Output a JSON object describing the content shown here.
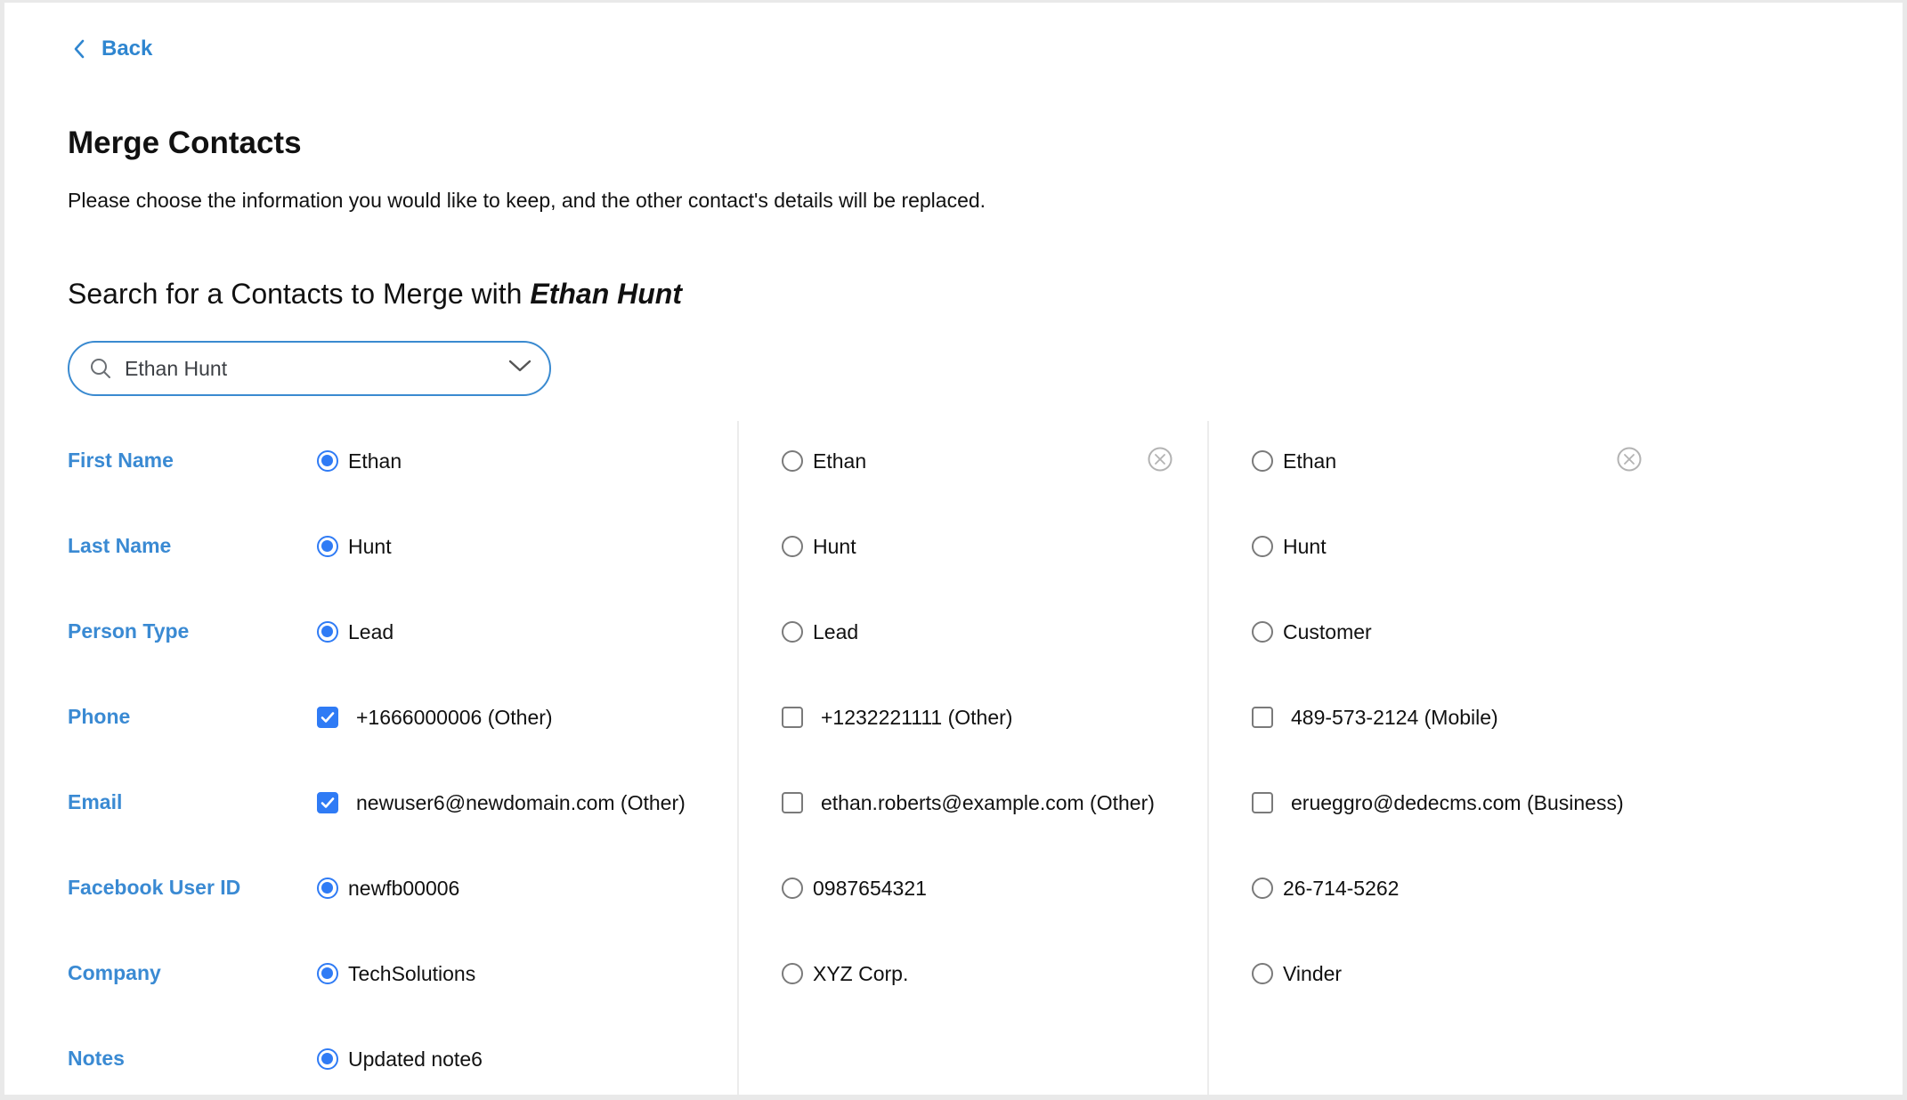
{
  "nav": {
    "back_label": "Back"
  },
  "header": {
    "title": "Merge Contacts",
    "description": "Please choose the information you would like to keep, and the other contact's details will be replaced."
  },
  "search": {
    "heading_prefix": "Search for a Contacts to Merge with ",
    "heading_name": "Ethan Hunt",
    "value": "Ethan Hunt",
    "icon": "search-icon",
    "dropdown_icon": "chevron-down-icon"
  },
  "colors": {
    "accent": "#2f7bf5",
    "label": "#3a8ad3",
    "link": "#2f86d0",
    "search_border": "#3a8ad0",
    "divider": "#ececec"
  },
  "fields": [
    {
      "label": "First Name",
      "type": "radio"
    },
    {
      "label": "Last Name",
      "type": "radio"
    },
    {
      "label": "Person Type",
      "type": "radio"
    },
    {
      "label": "Phone",
      "type": "checkbox"
    },
    {
      "label": "Email",
      "type": "checkbox"
    },
    {
      "label": "Facebook User ID",
      "type": "radio"
    },
    {
      "label": "Company",
      "type": "radio"
    },
    {
      "label": "Notes",
      "type": "radio"
    }
  ],
  "contacts": [
    {
      "removable": false,
      "values": [
        {
          "text": "Ethan",
          "selected": true
        },
        {
          "text": "Hunt",
          "selected": true
        },
        {
          "text": "Lead",
          "selected": true
        },
        {
          "text": "+1666000006 (Other)",
          "selected": true
        },
        {
          "text": "newuser6@newdomain.com (Other)",
          "selected": true
        },
        {
          "text": "newfb00006",
          "selected": true
        },
        {
          "text": "TechSolutions",
          "selected": true
        },
        {
          "text": "Updated note6",
          "selected": true
        }
      ]
    },
    {
      "removable": true,
      "values": [
        {
          "text": "Ethan",
          "selected": false
        },
        {
          "text": "Hunt",
          "selected": false
        },
        {
          "text": "Lead",
          "selected": false
        },
        {
          "text": "+1232221111 (Other)",
          "selected": false
        },
        {
          "text": "ethan.roberts@example.com (Other)",
          "selected": false
        },
        {
          "text": "0987654321",
          "selected": false
        },
        {
          "text": "XYZ Corp.",
          "selected": false
        },
        null
      ]
    },
    {
      "removable": true,
      "values": [
        {
          "text": "Ethan",
          "selected": false
        },
        {
          "text": "Hunt",
          "selected": false
        },
        {
          "text": "Customer",
          "selected": false
        },
        {
          "text": "489-573-2124 (Mobile)",
          "selected": false
        },
        {
          "text": "erueggro@dedecms.com (Business)",
          "selected": false
        },
        {
          "text": "26-714-5262",
          "selected": false
        },
        {
          "text": "Vinder",
          "selected": false
        },
        null
      ]
    }
  ]
}
